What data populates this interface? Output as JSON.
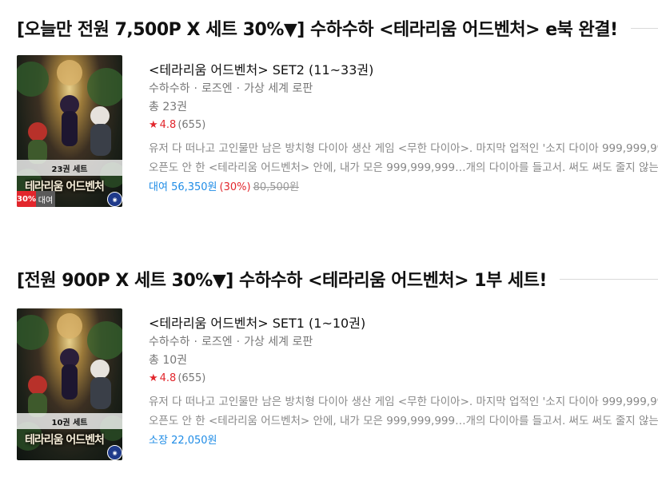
{
  "sections": [
    {
      "title": "[오늘만 전원 7,500P X 세트 30%▼] 수하수하 <테라리움 어드벤처> e북 완결!",
      "book": {
        "title": "<테라리움 어드벤처> SET2 (11~33권)",
        "author": "수하수하",
        "illustrator": "로즈엔",
        "genre": "가상 세계 로판",
        "volumes": "총 23권",
        "rating": "4.8",
        "rating_count": "(655)",
        "desc_line1": "유저 다 떠나고 고인물만 남은 방치형 다이아 생산 게임 <무한 다이아>. 마지막 업적인 '소지 다이아 999,999,999개'를",
        "desc_line2": "오픈도 안 한 <테라리움 어드벤처> 안에, 내가 모은 999,999,999…개의 다이아를 들고서. 써도 써도 줄지 않는 다이아",
        "cover_band": "23권 세트",
        "cover_title": "테라리움 어드벤처",
        "badge_sale": "30%",
        "badge_rent": "대여",
        "price_label": "대여",
        "price": "56,350원",
        "discount": "(30%)",
        "original_price": "80,500원"
      }
    },
    {
      "title": "[전원 900P X 세트 30%▼] 수하수하 <테라리움 어드벤처> 1부 세트!",
      "book": {
        "title": "<테라리움 어드벤처> SET1 (1~10권)",
        "author": "수하수하",
        "illustrator": "로즈엔",
        "genre": "가상 세계 로판",
        "volumes": "총 10권",
        "rating": "4.8",
        "rating_count": "(655)",
        "desc_line1": "유저 다 떠나고 고인물만 남은 방치형 다이아 생산 게임 <무한 다이아>. 마지막 업적인 '소지 다이아 999,999,999개'를",
        "desc_line2": "오픈도 안 한 <테라리움 어드벤처> 안에, 내가 모은 999,999,999…개의 다이아를 들고서. 써도 써도 줄지 않는 다이아",
        "cover_band": "10권 세트",
        "cover_title": "테라리움 어드벤처",
        "price_label": "소장",
        "price": "22,050원"
      }
    }
  ],
  "icons": {
    "star": "star-icon",
    "publisher": "publisher-logo"
  },
  "colors": {
    "price_blue": "#1f8ce6",
    "sale_red": "#e2262c"
  }
}
